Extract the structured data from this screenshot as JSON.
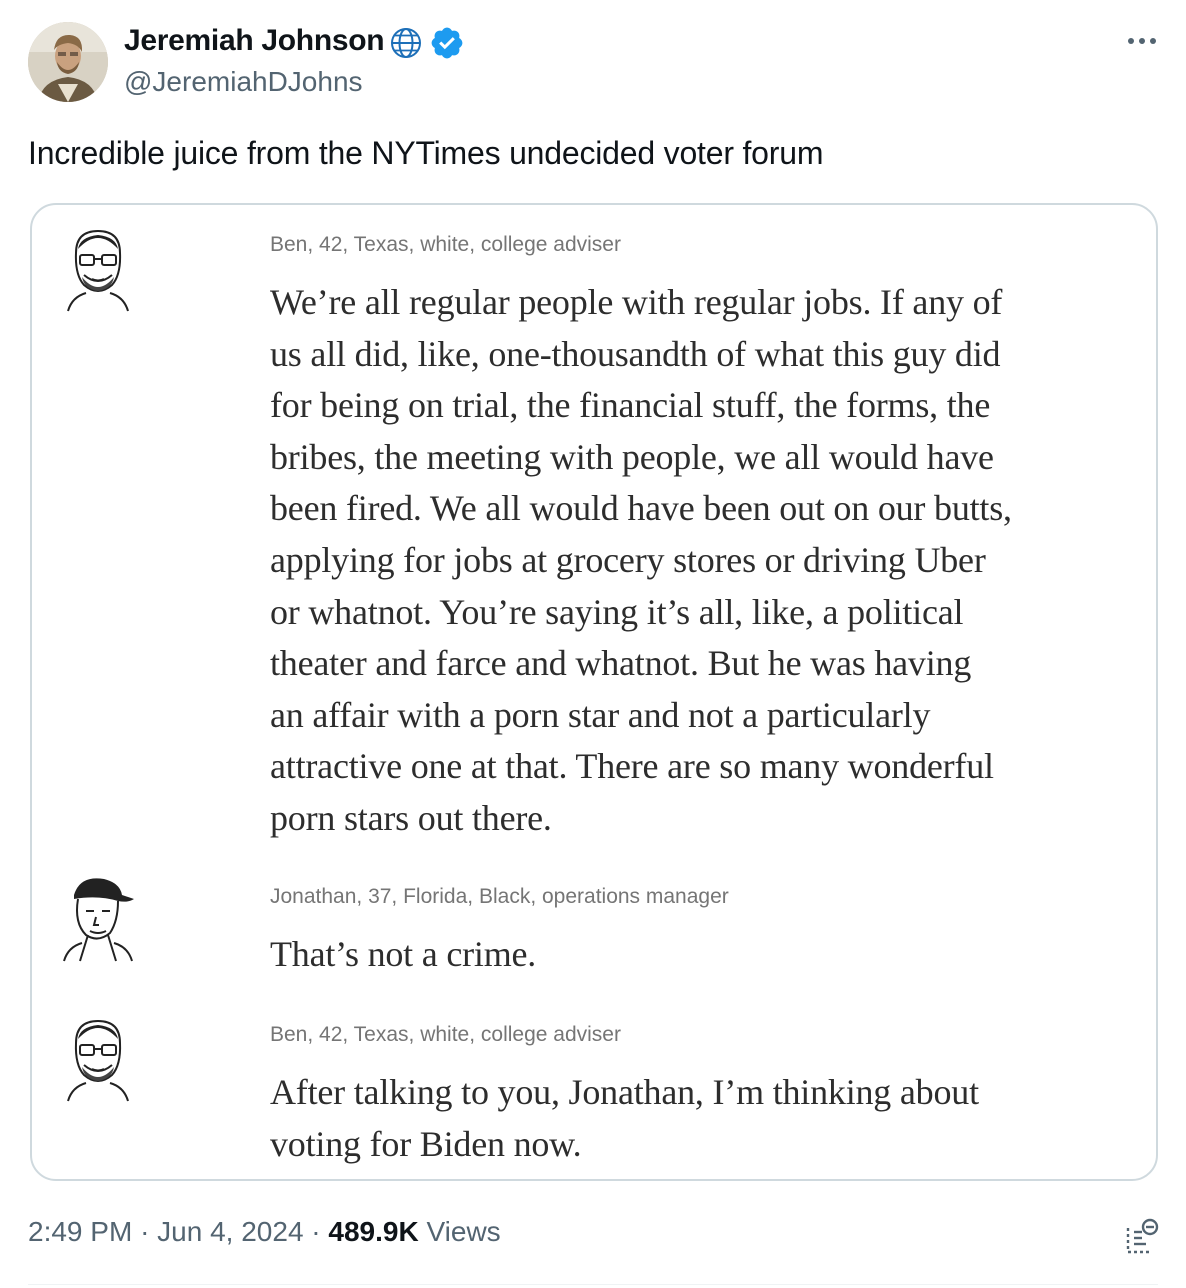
{
  "author": {
    "name": "Jeremiah Johnson",
    "handle": "@JeremiahDJohns",
    "affiliation_icon": "globe-icon",
    "verified_icon": "verified-badge-icon",
    "verified_color": "#1d9bf0"
  },
  "tweet": {
    "text": "Incredible juice from the NYTimes undecided voter forum"
  },
  "media": {
    "entries": [
      {
        "speaker": "Ben, 42, Texas, white, college adviser",
        "avatar_icon": "bearded-man-sketch-icon",
        "lines": [
          "We’re all regular people with regular jobs. If any of",
          "us all did, like, one-thousandth of what this guy did",
          "for being on trial, the financial stuff, the forms, the",
          "bribes, the meeting with people, we all would have",
          "been fired. We all would have been out on our butts,",
          "applying for jobs at grocery stores or driving Uber",
          "or whatnot. You’re saying it’s all, like, a political",
          "theater and farce and whatnot. But he was having",
          "an affair with a porn star and not a particularly",
          "attractive one at that. There are so many wonderful",
          "porn stars out there."
        ]
      },
      {
        "speaker": "Jonathan, 37, Florida, Black, operations manager",
        "avatar_icon": "man-in-cap-sketch-icon",
        "lines": [
          "That’s not a crime."
        ]
      },
      {
        "speaker": "Ben, 42, Texas, white, college adviser",
        "avatar_icon": "bearded-man-sketch-icon",
        "lines": [
          "After talking to you, Jonathan, I’m thinking about",
          "voting for Biden now."
        ]
      }
    ]
  },
  "meta": {
    "time": "2:49 PM",
    "separator": "·",
    "date": "Jun 4, 2024",
    "views_count": "489.9K",
    "views_label": "Views"
  },
  "icons": {
    "more": "more-options-icon",
    "analytics": "view-analytics-icon"
  }
}
